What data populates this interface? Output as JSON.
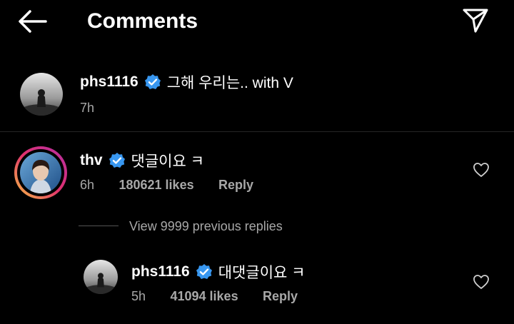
{
  "header": {
    "title": "Comments"
  },
  "caption": {
    "username": "phs1116",
    "text": "그해 우리는.. with V",
    "time": "7h"
  },
  "comment": {
    "username": "thv",
    "text": "댓글이요 ㅋ",
    "time": "6h",
    "likes": "180621 likes",
    "reply_label": "Reply"
  },
  "view_replies": "View 9999 previous replies",
  "reply": {
    "username": "phs1116",
    "text": "대댓글이요 ㅋ",
    "time": "5h",
    "likes": "41094 likes",
    "reply_label": "Reply"
  },
  "colors": {
    "background": "#000000",
    "verified": "#3897f0",
    "muted_text": "#a8a8a8",
    "story_ring": "#e1306c"
  },
  "icons": [
    "back-arrow-icon",
    "send-icon",
    "verified-badge-icon",
    "heart-icon"
  ]
}
